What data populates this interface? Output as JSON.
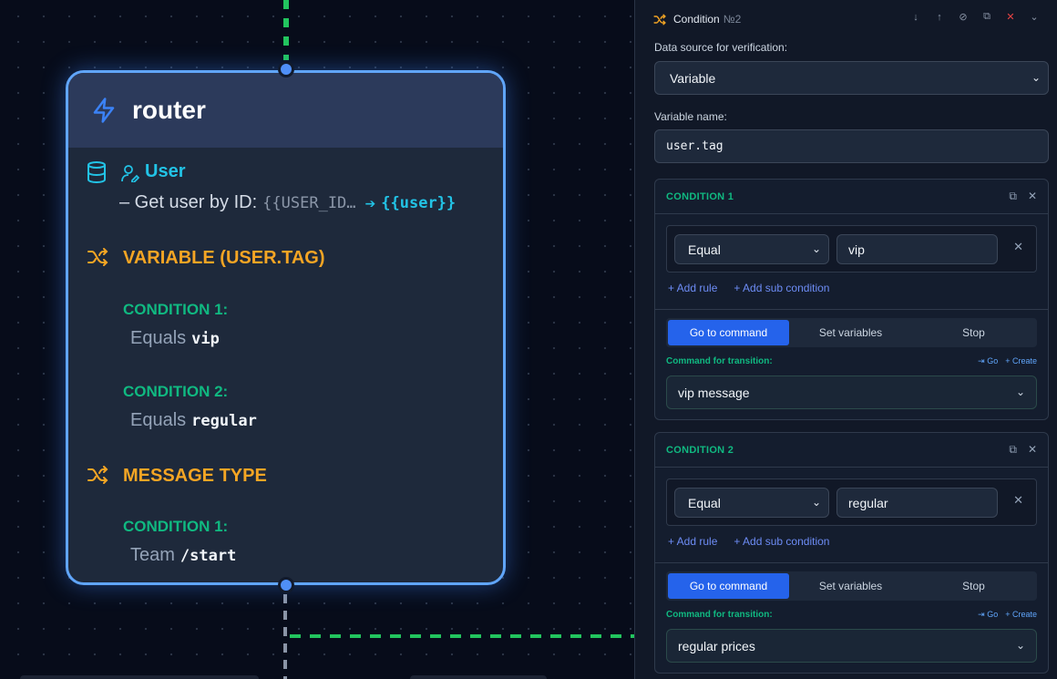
{
  "node": {
    "title": "router",
    "user_label": "User",
    "get_user_text": "– Get user by ID:",
    "get_user_var": "{{USER_ID…",
    "get_user_arrow": "➔",
    "get_user_result": "{{user}}",
    "sections": [
      {
        "title": "VARIABLE (USER.TAG)",
        "conditions": [
          {
            "label": "CONDITION 1:",
            "op": "Equals",
            "value": "vip"
          },
          {
            "label": "CONDITION 2:",
            "op": "Equals",
            "value": "regular"
          }
        ]
      },
      {
        "title": "MESSAGE TYPE",
        "conditions": [
          {
            "label": "CONDITION 1:",
            "op": "Team",
            "value": "/start"
          }
        ]
      }
    ]
  },
  "panel": {
    "title": "Condition",
    "number": "№2",
    "header_icons": [
      "↓",
      "↑",
      "⊘",
      "⧉",
      "✕",
      "⌄"
    ],
    "data_source_label": "Data source for verification:",
    "data_source_value": "Variable",
    "variable_name_label": "Variable name:",
    "variable_name_value": "user.tag",
    "conditions": [
      {
        "title": "CONDITION 1",
        "rule_op": "Equal",
        "rule_value": "vip",
        "add_rule": "+ Add rule",
        "add_sub": "+ Add sub condition",
        "tabs": [
          "Go to command",
          "Set variables",
          "Stop"
        ],
        "command_label": "Command for transition:",
        "go_label": "⇥ Go",
        "create_label": "+ Create",
        "command_value": "vip message"
      },
      {
        "title": "CONDITION 2",
        "rule_op": "Equal",
        "rule_value": "regular",
        "add_rule": "+ Add rule",
        "add_sub": "+ Add sub condition",
        "tabs": [
          "Go to command",
          "Set variables",
          "Stop"
        ],
        "command_label": "Command for transition:",
        "go_label": "⇥ Go",
        "create_label": "+ Create",
        "command_value": "regular prices"
      }
    ]
  },
  "colors": {
    "accent_blue": "#2563eb",
    "node_border": "#60a5fa",
    "section_orange": "#f5a524",
    "condition_green": "#10b981",
    "user_cyan": "#22c3e6"
  }
}
